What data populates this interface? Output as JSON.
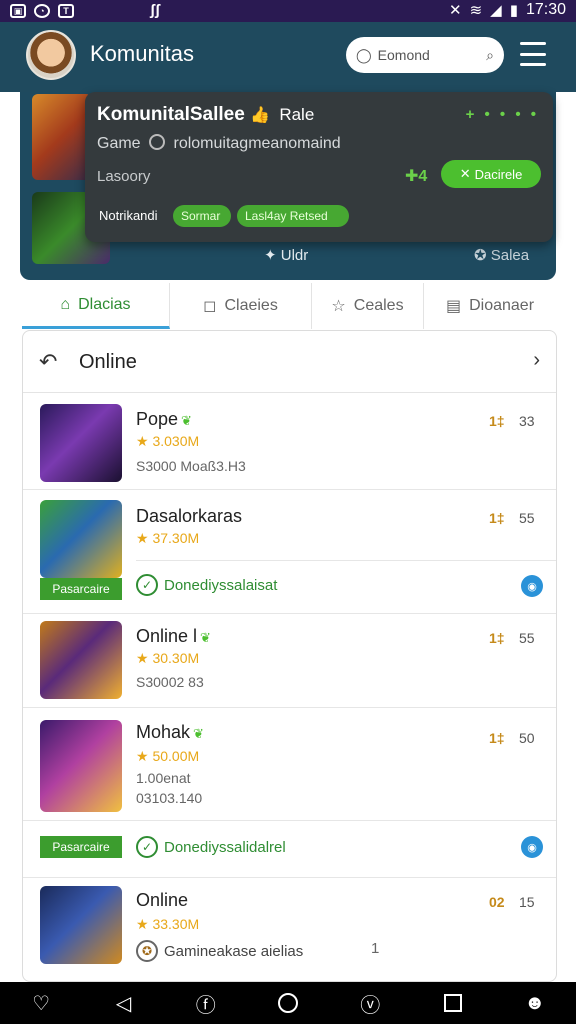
{
  "statusbar": {
    "time": "17:30"
  },
  "header": {
    "title": "Komunitas",
    "search_placeholder": "Eomond"
  },
  "featured": {
    "popup_title": "KomunitalSallee",
    "popup_tag": "Rale",
    "popup_game_label": "Game",
    "popup_game_text": "rolomuitagmeanomaind",
    "popup_subtitle": "Lasoory",
    "popup_count": "4",
    "popup_action": "Dacirele",
    "popup_footer_label": "Notrikandi",
    "popup_chip1": "Sormar",
    "popup_chip2": "Lasl4ay Retsed",
    "sub_left": "Uldr",
    "sub_right": "Salea"
  },
  "tabs": [
    {
      "label": "Dlacias"
    },
    {
      "label": "Claeies"
    },
    {
      "label": "Ceales"
    },
    {
      "label": "Dioanaer"
    }
  ],
  "list": {
    "title": "Online",
    "items": [
      {
        "name": "Pope",
        "rating": "3.030M",
        "meta": "S3000  Moaß3.H3",
        "rank": "1‡",
        "time": "33"
      },
      {
        "name": "Dasalorkaras",
        "rating": "37.30M",
        "badge": "Pasarcaire",
        "status": "Donediyssalaisat",
        "rank": "1‡",
        "time": "55"
      },
      {
        "name": "Online l",
        "rating": "30.30M",
        "meta": "S30002 83",
        "rank": "1‡",
        "time": "55"
      },
      {
        "name": "Mohak",
        "rating": "50.00M",
        "meta2": "1.00enat",
        "meta": "03103.140",
        "badge": "Pasarcaire",
        "status": "Donediyssalidalrel",
        "rank": "1‡",
        "time": "50"
      },
      {
        "name": "Online",
        "rating": "33.30M",
        "status_plain": "Gamineakase aielias",
        "status_num": "1",
        "rank": "02",
        "time": "15"
      }
    ]
  },
  "colors": {
    "header_bg": "#1f4a5e",
    "accent_green": "#4cbf2f",
    "status_bar": "#2a1a52",
    "info_blue": "#2a92d8"
  }
}
